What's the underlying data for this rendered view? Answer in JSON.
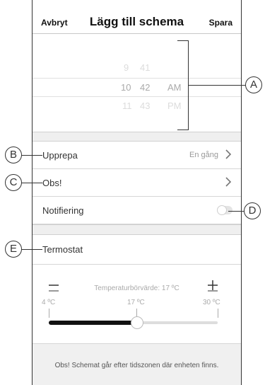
{
  "header": {
    "cancel_label": "Avbryt",
    "title": "Lägg till schema",
    "save_label": "Spara"
  },
  "time_picker": {
    "hours_above": "9",
    "minutes_above": "41",
    "hour_selected": "10",
    "minute_selected": "42",
    "period_selected": "AM",
    "hour_below": "11",
    "minute_below": "43",
    "period_below": "PM"
  },
  "rows": {
    "repeat": {
      "label": "Upprepa",
      "value": "En gång",
      "icon": "chevron-right-icon"
    },
    "note": {
      "label": "Obs!",
      "icon": "chevron-right-icon"
    },
    "notification": {
      "label": "Notifiering",
      "toggle_on": false
    }
  },
  "thermostat": {
    "label": "Termostat",
    "setpoint_text": "Temperaturbörvärde: 17 ºC",
    "min_label": "4 ºC",
    "current_label": "17 ºC",
    "max_label": "30 ºC",
    "min_value": 4,
    "max_value": 30,
    "current_value": 17,
    "minus_icon": "minus-icon",
    "plus_icon": "plus-icon"
  },
  "footer": {
    "note": "Obs! Schemat går efter tidszonen där enheten finns."
  },
  "callouts": {
    "a": "A",
    "b": "B",
    "c": "C",
    "d": "D",
    "e": "E"
  }
}
